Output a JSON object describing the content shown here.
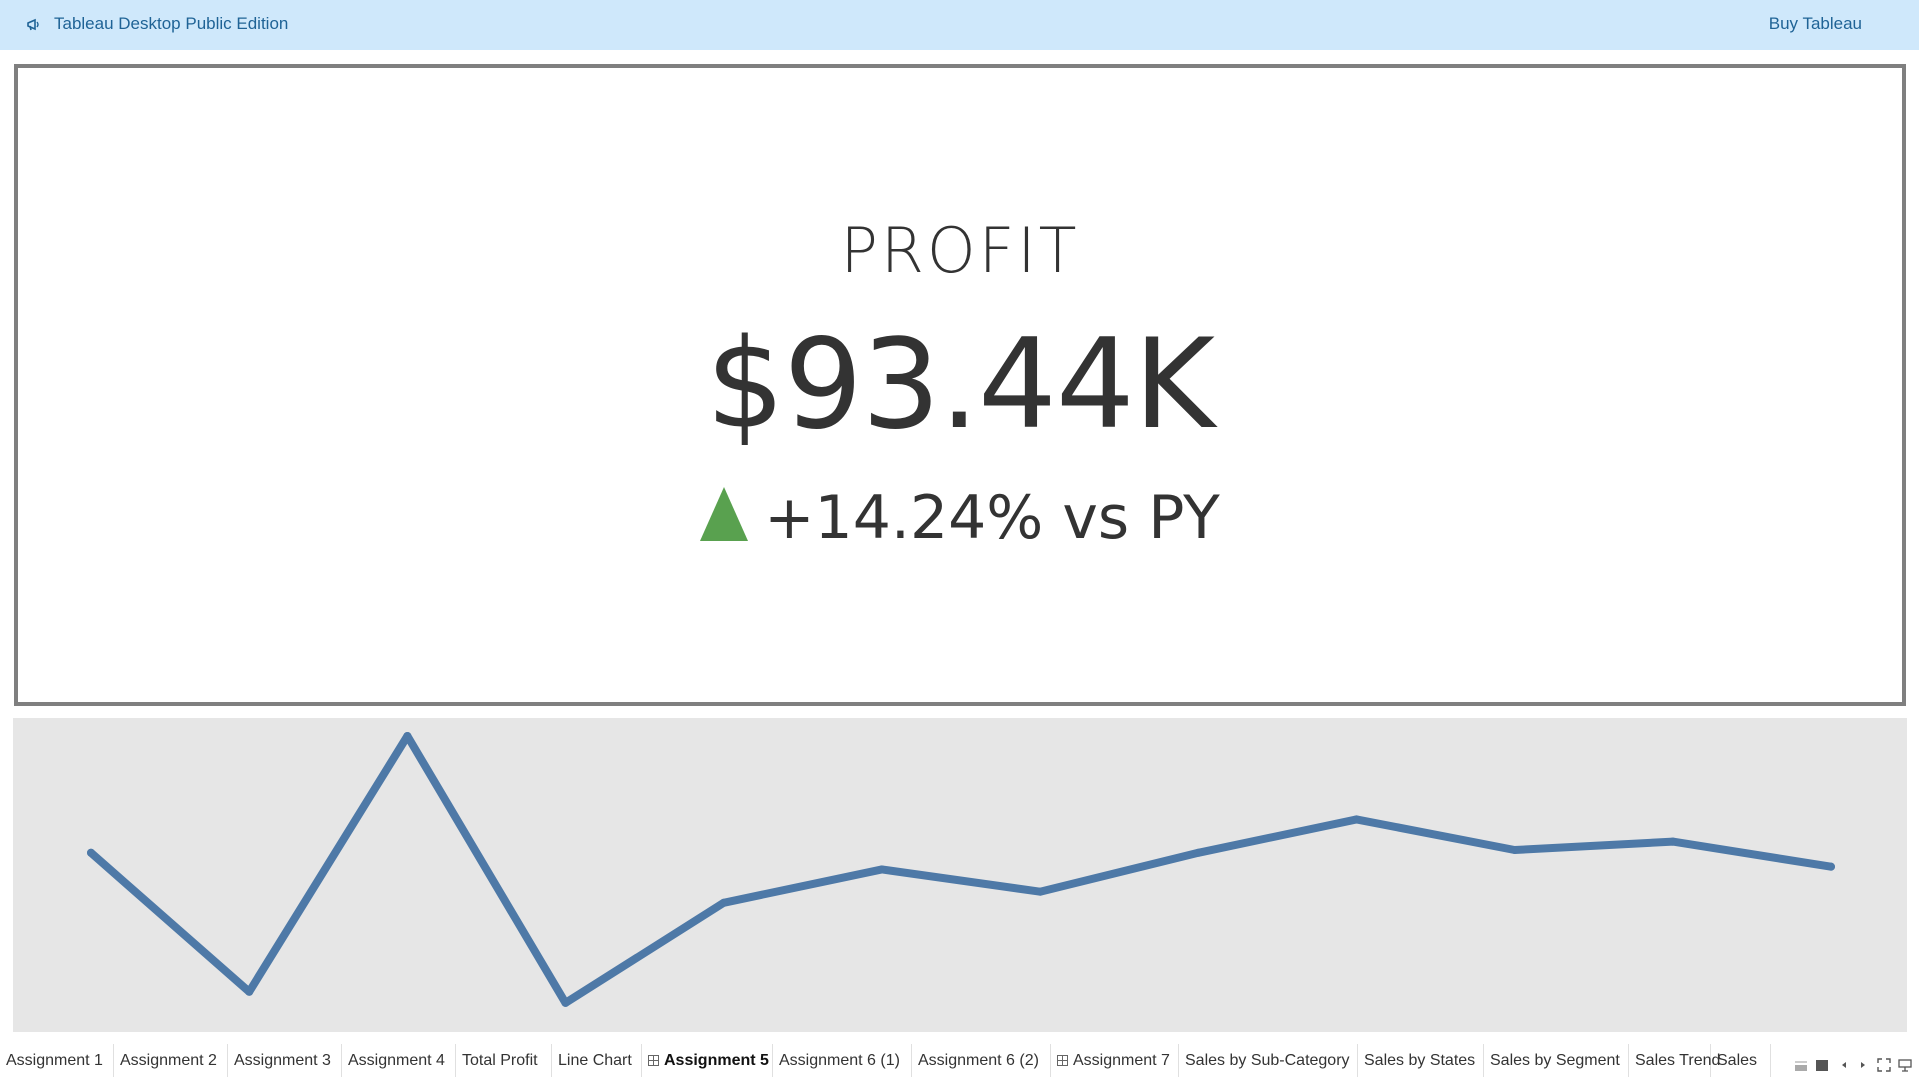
{
  "banner": {
    "title": "Tableau Desktop Public Edition",
    "buy_label": "Buy Tableau",
    "icon": "megaphone-icon",
    "color": "#1f6396"
  },
  "kpi": {
    "label": "PROFIT",
    "value": "$93.44K",
    "change": "+14.24% vs PY",
    "indicator_icon": "triangle-up-icon",
    "indicator_color": "#59a14f"
  },
  "chart_data": {
    "type": "line",
    "series": [
      {
        "values": [
          0.58,
          0.08,
          1.0,
          0.04,
          0.4,
          0.52,
          0.44,
          0.58,
          0.7,
          0.59,
          0.62,
          0.53
        ]
      }
    ],
    "color": "#4e79a7",
    "axes_visible": false,
    "grid": false
  },
  "tabs": [
    {
      "label": "Assignment 1",
      "active": false,
      "dashboard": false
    },
    {
      "label": "Assignment 2",
      "active": false,
      "dashboard": false
    },
    {
      "label": "Assignment 3",
      "active": false,
      "dashboard": false
    },
    {
      "label": "Assignment 4",
      "active": false,
      "dashboard": false
    },
    {
      "label": "Total Profit",
      "active": false,
      "dashboard": false
    },
    {
      "label": "Line Chart",
      "active": false,
      "dashboard": false
    },
    {
      "label": "Assignment 5",
      "active": true,
      "dashboard": true
    },
    {
      "label": "Assignment 6 (1)",
      "active": false,
      "dashboard": false
    },
    {
      "label": "Assignment 6 (2)",
      "active": false,
      "dashboard": false
    },
    {
      "label": "Assignment 7",
      "active": false,
      "dashboard": true
    },
    {
      "label": "Sales by Sub-Category",
      "active": false,
      "dashboard": false
    },
    {
      "label": "Sales by States",
      "active": false,
      "dashboard": false
    },
    {
      "label": "Sales by Segment",
      "active": false,
      "dashboard": false
    },
    {
      "label": "Sales Trend",
      "active": false,
      "dashboard": false
    },
    {
      "label": "Sales",
      "active": false,
      "dashboard": false
    }
  ],
  "controls": [
    "filmstrip-view-icon",
    "grid-view-icon",
    "scroll-left-icon",
    "scroll-right-icon",
    "fullscreen-icon",
    "presentation-icon"
  ]
}
